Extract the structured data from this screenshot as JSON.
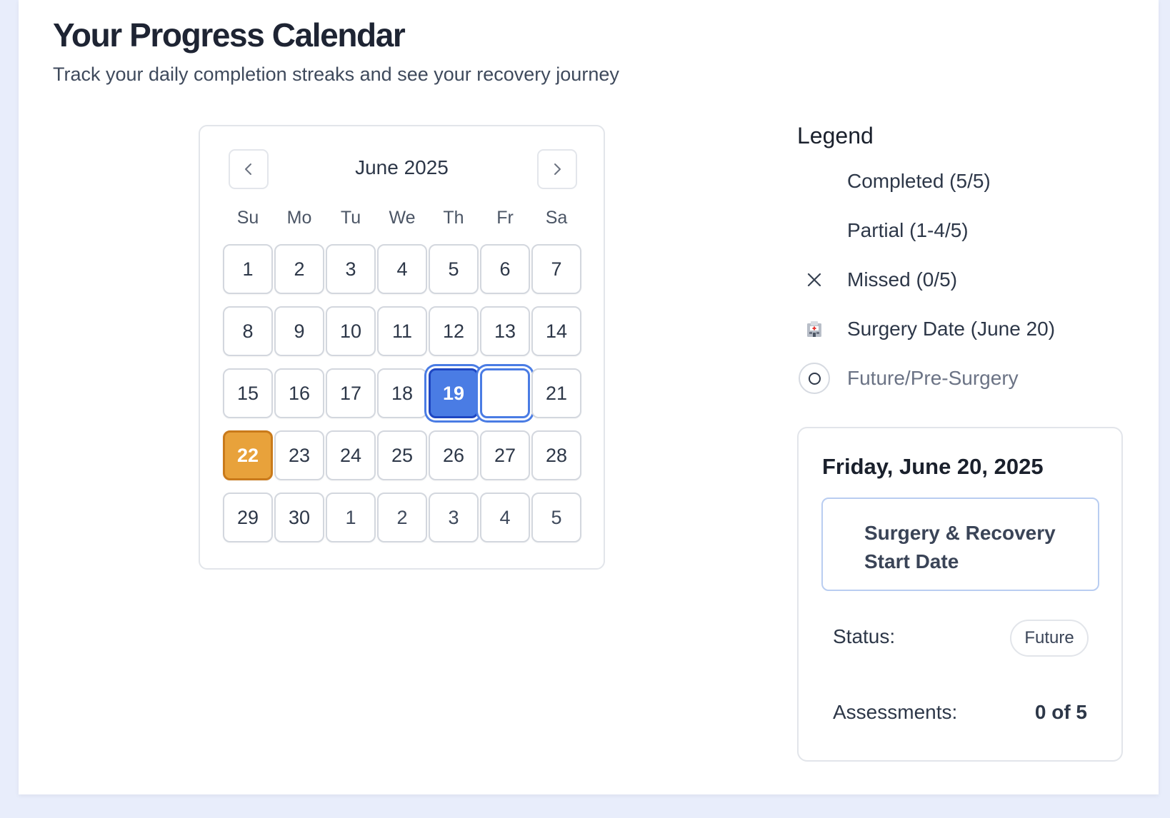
{
  "header": {
    "title": "Your Progress Calendar",
    "subtitle": "Track your daily completion streaks and see your recovery journey"
  },
  "calendar": {
    "month_label": "June 2025",
    "prev_icon": "chevron-left-icon",
    "next_icon": "chevron-right-icon",
    "weekdays": [
      "Su",
      "Mo",
      "Tu",
      "We",
      "Th",
      "Fr",
      "Sa"
    ],
    "days": [
      {
        "label": "1",
        "state": "normal"
      },
      {
        "label": "2",
        "state": "normal"
      },
      {
        "label": "3",
        "state": "normal"
      },
      {
        "label": "4",
        "state": "normal"
      },
      {
        "label": "5",
        "state": "normal"
      },
      {
        "label": "6",
        "state": "normal"
      },
      {
        "label": "7",
        "state": "normal"
      },
      {
        "label": "8",
        "state": "normal"
      },
      {
        "label": "9",
        "state": "normal"
      },
      {
        "label": "10",
        "state": "normal"
      },
      {
        "label": "11",
        "state": "normal"
      },
      {
        "label": "12",
        "state": "normal"
      },
      {
        "label": "13",
        "state": "normal"
      },
      {
        "label": "14",
        "state": "normal"
      },
      {
        "label": "15",
        "state": "normal"
      },
      {
        "label": "16",
        "state": "normal"
      },
      {
        "label": "17",
        "state": "normal"
      },
      {
        "label": "18",
        "state": "normal"
      },
      {
        "label": "19",
        "state": "today"
      },
      {
        "label": "",
        "state": "surgery"
      },
      {
        "label": "21",
        "state": "normal"
      },
      {
        "label": "22",
        "state": "streak"
      },
      {
        "label": "23",
        "state": "normal"
      },
      {
        "label": "24",
        "state": "normal"
      },
      {
        "label": "25",
        "state": "normal"
      },
      {
        "label": "26",
        "state": "normal"
      },
      {
        "label": "27",
        "state": "normal"
      },
      {
        "label": "28",
        "state": "normal"
      },
      {
        "label": "29",
        "state": "normal"
      },
      {
        "label": "30",
        "state": "normal"
      },
      {
        "label": "1",
        "state": "other"
      },
      {
        "label": "2",
        "state": "other"
      },
      {
        "label": "3",
        "state": "other"
      },
      {
        "label": "4",
        "state": "other"
      },
      {
        "label": "5",
        "state": "other"
      }
    ],
    "colors": {
      "today": "#4a7ce4",
      "surgery_ring": "#4a7ce4",
      "streak": "#e8a23b"
    }
  },
  "legend": {
    "title": "Legend",
    "items": [
      {
        "label": "Completed (5/5)",
        "icon": "none"
      },
      {
        "label": "Partial (1-4/5)",
        "icon": "none"
      },
      {
        "label": "Missed (0/5)",
        "icon": "x-icon"
      },
      {
        "label": "Surgery Date (June 20)",
        "icon": "hospital-icon"
      },
      {
        "label": "Future/Pre-Surgery",
        "icon": "circle-icon"
      }
    ]
  },
  "detail": {
    "date": "Friday, June 20, 2025",
    "event": "Surgery & Recovery Start Date",
    "status_label": "Status:",
    "status_value": "Future",
    "assessments_label": "Assessments:",
    "assessments_value": "0 of 5"
  }
}
